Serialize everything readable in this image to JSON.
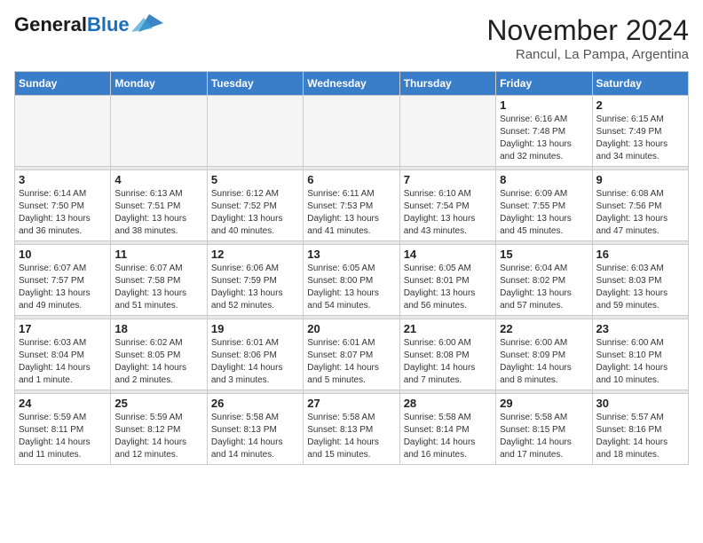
{
  "header": {
    "logo_line1": "General",
    "logo_line2": "Blue",
    "month": "November 2024",
    "location": "Rancul, La Pampa, Argentina"
  },
  "days_of_week": [
    "Sunday",
    "Monday",
    "Tuesday",
    "Wednesday",
    "Thursday",
    "Friday",
    "Saturday"
  ],
  "weeks": [
    [
      {
        "day": "",
        "info": ""
      },
      {
        "day": "",
        "info": ""
      },
      {
        "day": "",
        "info": ""
      },
      {
        "day": "",
        "info": ""
      },
      {
        "day": "",
        "info": ""
      },
      {
        "day": "1",
        "info": "Sunrise: 6:16 AM\nSunset: 7:48 PM\nDaylight: 13 hours\nand 32 minutes."
      },
      {
        "day": "2",
        "info": "Sunrise: 6:15 AM\nSunset: 7:49 PM\nDaylight: 13 hours\nand 34 minutes."
      }
    ],
    [
      {
        "day": "3",
        "info": "Sunrise: 6:14 AM\nSunset: 7:50 PM\nDaylight: 13 hours\nand 36 minutes."
      },
      {
        "day": "4",
        "info": "Sunrise: 6:13 AM\nSunset: 7:51 PM\nDaylight: 13 hours\nand 38 minutes."
      },
      {
        "day": "5",
        "info": "Sunrise: 6:12 AM\nSunset: 7:52 PM\nDaylight: 13 hours\nand 40 minutes."
      },
      {
        "day": "6",
        "info": "Sunrise: 6:11 AM\nSunset: 7:53 PM\nDaylight: 13 hours\nand 41 minutes."
      },
      {
        "day": "7",
        "info": "Sunrise: 6:10 AM\nSunset: 7:54 PM\nDaylight: 13 hours\nand 43 minutes."
      },
      {
        "day": "8",
        "info": "Sunrise: 6:09 AM\nSunset: 7:55 PM\nDaylight: 13 hours\nand 45 minutes."
      },
      {
        "day": "9",
        "info": "Sunrise: 6:08 AM\nSunset: 7:56 PM\nDaylight: 13 hours\nand 47 minutes."
      }
    ],
    [
      {
        "day": "10",
        "info": "Sunrise: 6:07 AM\nSunset: 7:57 PM\nDaylight: 13 hours\nand 49 minutes."
      },
      {
        "day": "11",
        "info": "Sunrise: 6:07 AM\nSunset: 7:58 PM\nDaylight: 13 hours\nand 51 minutes."
      },
      {
        "day": "12",
        "info": "Sunrise: 6:06 AM\nSunset: 7:59 PM\nDaylight: 13 hours\nand 52 minutes."
      },
      {
        "day": "13",
        "info": "Sunrise: 6:05 AM\nSunset: 8:00 PM\nDaylight: 13 hours\nand 54 minutes."
      },
      {
        "day": "14",
        "info": "Sunrise: 6:05 AM\nSunset: 8:01 PM\nDaylight: 13 hours\nand 56 minutes."
      },
      {
        "day": "15",
        "info": "Sunrise: 6:04 AM\nSunset: 8:02 PM\nDaylight: 13 hours\nand 57 minutes."
      },
      {
        "day": "16",
        "info": "Sunrise: 6:03 AM\nSunset: 8:03 PM\nDaylight: 13 hours\nand 59 minutes."
      }
    ],
    [
      {
        "day": "17",
        "info": "Sunrise: 6:03 AM\nSunset: 8:04 PM\nDaylight: 14 hours\nand 1 minute."
      },
      {
        "day": "18",
        "info": "Sunrise: 6:02 AM\nSunset: 8:05 PM\nDaylight: 14 hours\nand 2 minutes."
      },
      {
        "day": "19",
        "info": "Sunrise: 6:01 AM\nSunset: 8:06 PM\nDaylight: 14 hours\nand 3 minutes."
      },
      {
        "day": "20",
        "info": "Sunrise: 6:01 AM\nSunset: 8:07 PM\nDaylight: 14 hours\nand 5 minutes."
      },
      {
        "day": "21",
        "info": "Sunrise: 6:00 AM\nSunset: 8:08 PM\nDaylight: 14 hours\nand 7 minutes."
      },
      {
        "day": "22",
        "info": "Sunrise: 6:00 AM\nSunset: 8:09 PM\nDaylight: 14 hours\nand 8 minutes."
      },
      {
        "day": "23",
        "info": "Sunrise: 6:00 AM\nSunset: 8:10 PM\nDaylight: 14 hours\nand 10 minutes."
      }
    ],
    [
      {
        "day": "24",
        "info": "Sunrise: 5:59 AM\nSunset: 8:11 PM\nDaylight: 14 hours\nand 11 minutes."
      },
      {
        "day": "25",
        "info": "Sunrise: 5:59 AM\nSunset: 8:12 PM\nDaylight: 14 hours\nand 12 minutes."
      },
      {
        "day": "26",
        "info": "Sunrise: 5:58 AM\nSunset: 8:13 PM\nDaylight: 14 hours\nand 14 minutes."
      },
      {
        "day": "27",
        "info": "Sunrise: 5:58 AM\nSunset: 8:13 PM\nDaylight: 14 hours\nand 15 minutes."
      },
      {
        "day": "28",
        "info": "Sunrise: 5:58 AM\nSunset: 8:14 PM\nDaylight: 14 hours\nand 16 minutes."
      },
      {
        "day": "29",
        "info": "Sunrise: 5:58 AM\nSunset: 8:15 PM\nDaylight: 14 hours\nand 17 minutes."
      },
      {
        "day": "30",
        "info": "Sunrise: 5:57 AM\nSunset: 8:16 PM\nDaylight: 14 hours\nand 18 minutes."
      }
    ]
  ]
}
